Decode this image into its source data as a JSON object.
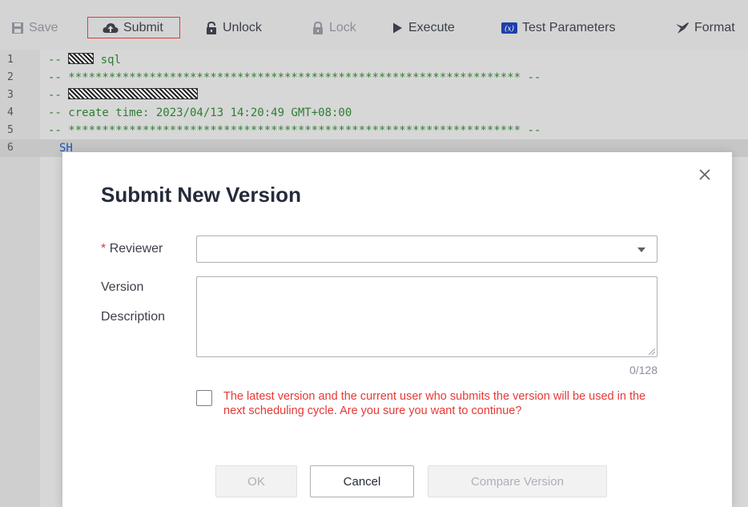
{
  "toolbar": {
    "save": "Save",
    "submit": "Submit",
    "unlock": "Unlock",
    "lock": "Lock",
    "execute": "Execute",
    "test_parameters": "Test Parameters",
    "format": "Format"
  },
  "editor": {
    "lines": [
      {
        "num": "1",
        "prefix": "-- ",
        "text": " sql"
      },
      {
        "num": "2",
        "text": "-- ******************************************************************* --"
      },
      {
        "num": "3",
        "prefix": "-- ",
        "text": ""
      },
      {
        "num": "4",
        "text": "-- create time: 2023/04/13 14:20:49 GMT+08:00"
      },
      {
        "num": "5",
        "text": "-- ******************************************************************* --"
      },
      {
        "num": "6",
        "text": "SH"
      }
    ]
  },
  "dialog": {
    "title": "Submit New Version",
    "required_mark": "*",
    "reviewer_label": "Reviewer",
    "reviewer_value": "",
    "version_label": "Version",
    "description_label": "Description",
    "description_value": "",
    "counter": "0/128",
    "warning": "The latest version and the current user who submits the version will be used in the next scheduling cycle. Are you sure you want to continue?",
    "ok": "OK",
    "cancel": "Cancel",
    "compare": "Compare Version"
  },
  "colors": {
    "accent_red": "#e53935",
    "code_green": "#2e7d32",
    "code_blue": "#1c55b7"
  },
  "icons": [
    "save-icon",
    "cloud-upload-icon",
    "unlock-icon",
    "lock-icon",
    "play-icon",
    "parameters-icon",
    "format-brush-icon",
    "close-icon",
    "chevron-down-icon"
  ]
}
